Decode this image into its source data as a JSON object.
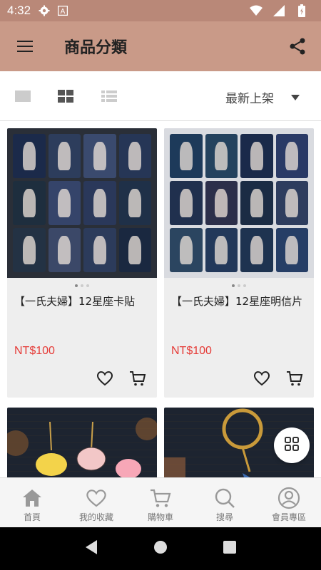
{
  "status_bar": {
    "time": "4:32",
    "icons": [
      "gear-icon",
      "app-a-icon",
      "wifi-icon",
      "signal-icon",
      "battery-icon"
    ]
  },
  "app_bar": {
    "title": "商品分類",
    "menu_icon": "hamburger-menu-icon",
    "share_icon": "share-icon"
  },
  "toolbar": {
    "views": [
      "single-view-icon",
      "grid-view-icon",
      "list-view-icon"
    ],
    "sort_label": "最新上架"
  },
  "products": [
    {
      "name": "【一氏夫婦】12星座卡貼",
      "price": "NT$100"
    },
    {
      "name": "【一氏夫婦】12星座明信片",
      "price": "NT$100"
    }
  ],
  "bottom_nav": [
    {
      "label": "首頁",
      "icon": "home-icon"
    },
    {
      "label": "我的收藏",
      "icon": "heart-icon"
    },
    {
      "label": "購物車",
      "icon": "cart-icon"
    },
    {
      "label": "搜尋",
      "icon": "search-icon"
    },
    {
      "label": "會員專區",
      "icon": "account-icon"
    }
  ],
  "colors": {
    "status_bar": "#b98878",
    "app_bar": "#c99a88",
    "price": "#e53935"
  }
}
